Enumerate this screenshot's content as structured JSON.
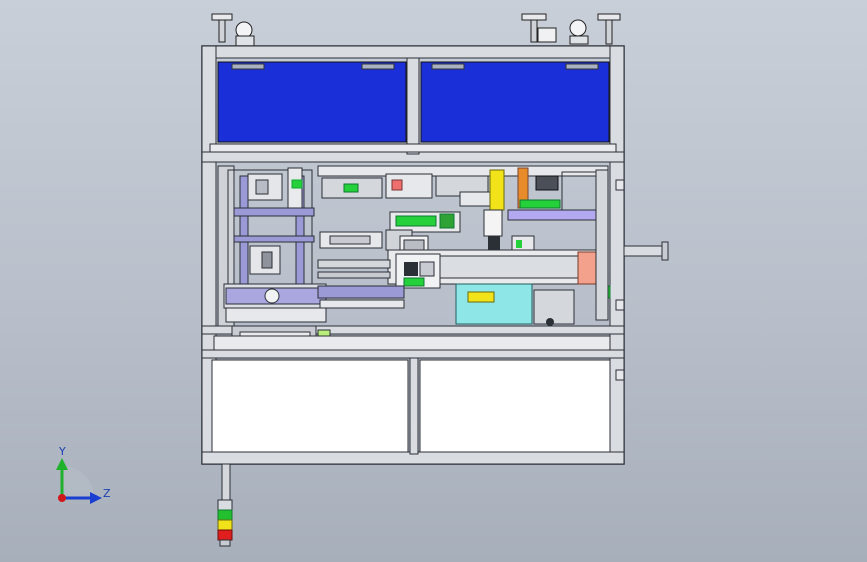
{
  "viewport": {
    "background_top": "#c9cfd8",
    "background_bottom": "#a7afbb"
  },
  "model": {
    "frame_color": "#d9dde2",
    "frame_edge": "#2b2f36",
    "panel_blue": "#1a2fd8",
    "rail_violet": "#9b9ad6",
    "accent_green": "#25d13a",
    "accent_yellow": "#f2e21a",
    "accent_salmon": "#f3a08c",
    "accent_cyan": "#8fe6e6"
  },
  "triad": {
    "y_label": "Y",
    "z_label": "Z",
    "y_color": "#1fb12b",
    "z_color": "#1a3fd0",
    "x_color": "#d0181a"
  },
  "signal_tower": {
    "icon": "signal-tower-icon",
    "lights": [
      "green",
      "yellow",
      "red"
    ]
  }
}
